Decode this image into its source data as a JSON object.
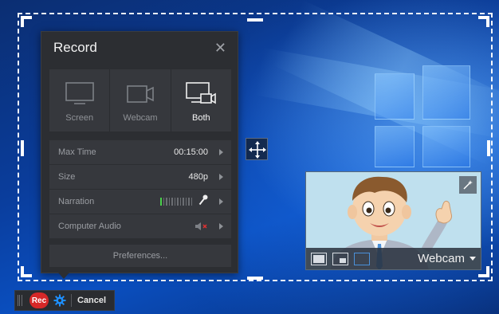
{
  "panel": {
    "title": "Record",
    "close_icon": "close-icon",
    "modes": [
      {
        "label": "Screen",
        "icon": "monitor-icon",
        "active": false
      },
      {
        "label": "Webcam",
        "icon": "webcam-icon",
        "active": false
      },
      {
        "label": "Both",
        "icon": "monitor-webcam-icon",
        "active": true
      }
    ],
    "settings": {
      "max_time": {
        "label": "Max Time",
        "value": "00:15:00"
      },
      "size": {
        "label": "Size",
        "value": "480p"
      },
      "narration": {
        "label": "Narration",
        "level": 0.1,
        "icon": "microphone-icon"
      },
      "computer_audio": {
        "label": "Computer Audio",
        "icon": "speaker-muted-icon"
      }
    },
    "preferences_label": "Preferences..."
  },
  "webcam": {
    "source_label": "Webcam",
    "layouts": [
      "full-layout-icon",
      "pip-layout-icon",
      "hide-layout-icon"
    ],
    "enhance_icon": "magic-wand-icon"
  },
  "rec_bar": {
    "rec_label": "Rec",
    "cancel_label": "Cancel",
    "gear_icon": "gear-icon"
  },
  "colors": {
    "accent_blue": "#1e8fff",
    "rec_red": "#d62828",
    "meter_green": "#49d04a",
    "panel_bg": "#2c2e32"
  }
}
